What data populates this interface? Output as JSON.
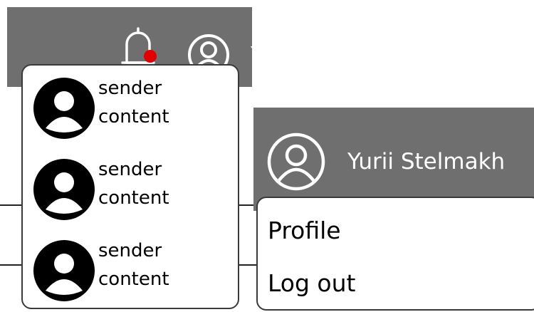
{
  "header_left": {
    "bell_icon": "bell-icon",
    "notification_dot_color": "#e10000",
    "user_icon": "user-circle-icon",
    "truncated_name": "Y"
  },
  "notifications": [
    {
      "sender": "sender",
      "content": "content",
      "avatar_icon": "avatar-icon"
    },
    {
      "sender": "sender",
      "content": "content",
      "avatar_icon": "avatar-icon"
    },
    {
      "sender": "sender",
      "content": "content",
      "avatar_icon": "avatar-icon"
    }
  ],
  "header_right": {
    "user_icon": "user-circle-icon",
    "user_name": "Yurii Stelmakh"
  },
  "profile_menu": {
    "items": [
      {
        "label": "Profile"
      },
      {
        "label": "Log out"
      }
    ]
  },
  "colors": {
    "header_bg": "#6f6f6f",
    "text_on_header": "#ffffff",
    "panel_border": "#3a3a3a"
  }
}
